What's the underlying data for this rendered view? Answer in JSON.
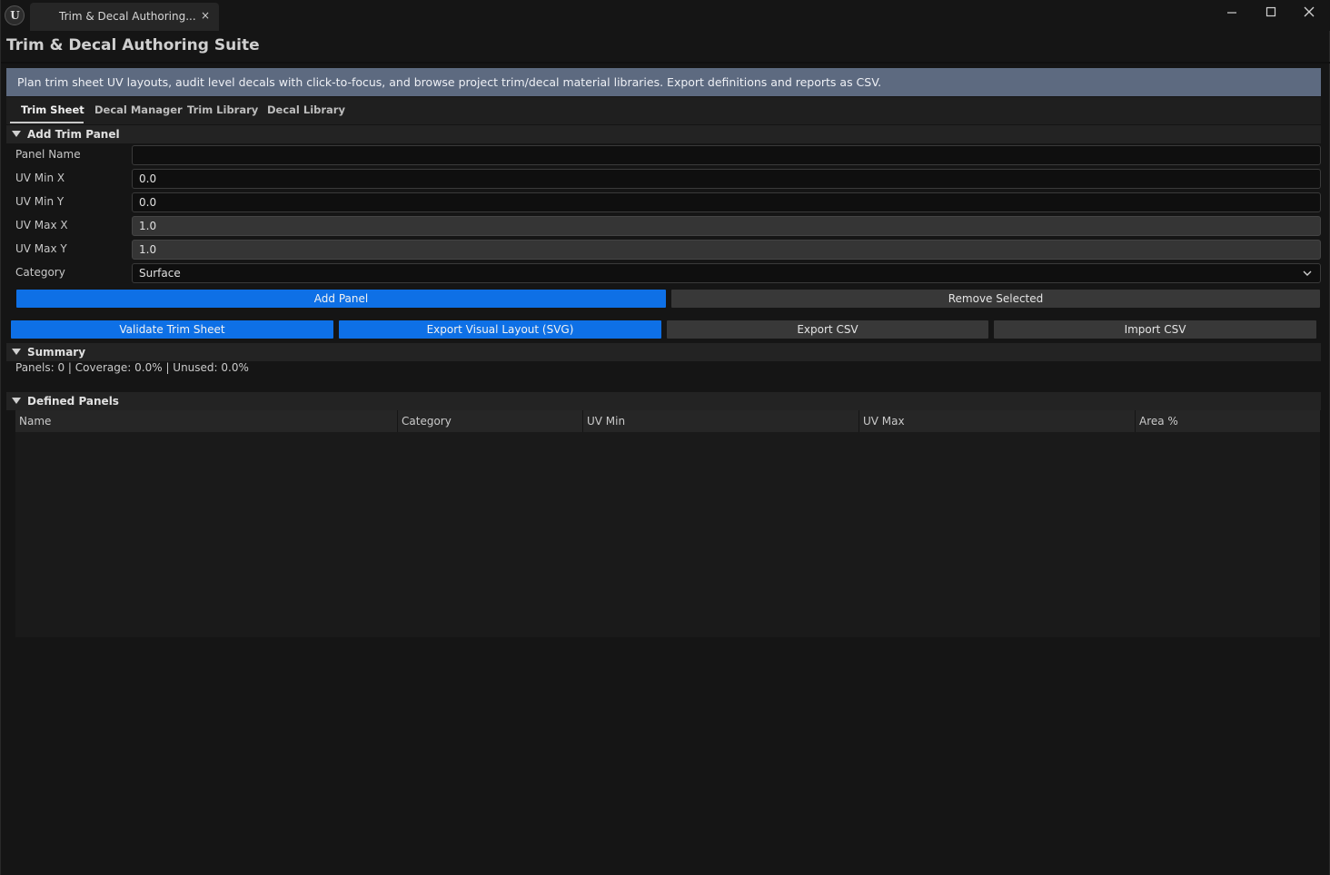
{
  "window": {
    "tab_title": "Trim & Decal Authoring...",
    "tab_close": "×"
  },
  "header": {
    "title": "Trim & Decal Authoring Suite",
    "info": "Plan trim sheet UV layouts, audit level decals with click-to-focus, and browse project trim/decal material libraries. Export definitions and reports as CSV."
  },
  "tabs": [
    {
      "label": "Trim Sheet",
      "active": true
    },
    {
      "label": "Decal Manager",
      "active": false
    },
    {
      "label": "Trim Library",
      "active": false
    },
    {
      "label": "Decal Library",
      "active": false
    }
  ],
  "add_panel": {
    "section_title": "Add Trim Panel",
    "fields": [
      {
        "label": "Panel Name",
        "value": ""
      },
      {
        "label": "UV Min X",
        "value": "0.0"
      },
      {
        "label": "UV Min Y",
        "value": "0.0"
      },
      {
        "label": "UV Max X",
        "value": "1.0"
      },
      {
        "label": "UV Max Y",
        "value": "1.0"
      }
    ],
    "category_label": "Category",
    "category_value": "Surface",
    "add_button": "Add Panel",
    "remove_button": "Remove Selected"
  },
  "actions": {
    "validate": "Validate Trim Sheet",
    "export_svg": "Export Visual Layout (SVG)",
    "export_csv": "Export CSV",
    "import_csv": "Import CSV"
  },
  "summary": {
    "section_title": "Summary",
    "text": "Panels: 0  |  Coverage: 0.0%  |  Unused: 0.0%"
  },
  "defined_panels": {
    "section_title": "Defined Panels",
    "columns": [
      "Name",
      "Category",
      "UV Min",
      "UV Max",
      "Area %"
    ],
    "rows": []
  },
  "colors": {
    "accent_blue": "#0e70e6",
    "info_bar": "#5d6a80",
    "background": "#151515"
  }
}
